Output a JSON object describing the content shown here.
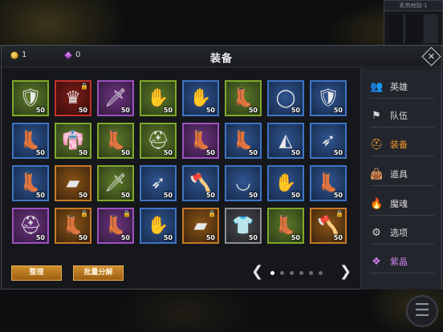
{
  "minimap": {
    "title": "炙热地狱-1"
  },
  "header": {
    "title": "装备",
    "gold": "1",
    "gems": "0",
    "close_icon": "close-x-icon"
  },
  "items": [
    {
      "icon": "chest-armor-icon",
      "glyph": "🛡",
      "rarity": "green",
      "count": "50",
      "locked": false
    },
    {
      "icon": "horned-helmet-icon",
      "glyph": "♛",
      "rarity": "red",
      "count": "50",
      "locked": true
    },
    {
      "icon": "sword-icon",
      "glyph": "🗡",
      "rarity": "purple",
      "count": "50",
      "locked": false
    },
    {
      "icon": "gloves-icon",
      "glyph": "✋",
      "rarity": "green",
      "count": "50",
      "locked": false
    },
    {
      "icon": "gloves-icon",
      "glyph": "✋",
      "rarity": "blue",
      "count": "50",
      "locked": false
    },
    {
      "icon": "boots-icon",
      "glyph": "👢",
      "rarity": "green",
      "count": "50",
      "locked": false
    },
    {
      "icon": "necklace-icon",
      "glyph": "◯",
      "rarity": "blue",
      "count": "50",
      "locked": false
    },
    {
      "icon": "leather-armor-icon",
      "glyph": "🛡",
      "rarity": "blue",
      "count": "50",
      "locked": false
    },
    {
      "icon": "boots-icon",
      "glyph": "👢",
      "rarity": "blue",
      "count": "50",
      "locked": false
    },
    {
      "icon": "robe-icon",
      "glyph": "👘",
      "rarity": "green",
      "count": "50",
      "locked": false
    },
    {
      "icon": "boots-icon",
      "glyph": "👢",
      "rarity": "green",
      "count": "50",
      "locked": false
    },
    {
      "icon": "helmet-icon",
      "glyph": "⛑",
      "rarity": "green",
      "count": "50",
      "locked": false
    },
    {
      "icon": "boots-icon",
      "glyph": "👢",
      "rarity": "purple",
      "count": "50",
      "locked": false
    },
    {
      "icon": "boots-icon",
      "glyph": "👢",
      "rarity": "blue",
      "count": "50",
      "locked": false
    },
    {
      "icon": "hood-icon",
      "glyph": "◭",
      "rarity": "blue",
      "count": "50",
      "locked": false
    },
    {
      "icon": "spear-icon",
      "glyph": "➶",
      "rarity": "blue",
      "count": "50",
      "locked": false
    },
    {
      "icon": "boots-icon",
      "glyph": "👢",
      "rarity": "blue",
      "count": "50",
      "locked": false
    },
    {
      "icon": "shield-icon",
      "glyph": "▰",
      "rarity": "orange",
      "count": "50",
      "locked": false
    },
    {
      "icon": "sword-icon",
      "glyph": "🗡",
      "rarity": "green",
      "count": "50",
      "locked": false
    },
    {
      "icon": "spear-icon",
      "glyph": "➶",
      "rarity": "blue",
      "count": "50",
      "locked": false
    },
    {
      "icon": "axe-icon",
      "glyph": "🪓",
      "rarity": "blue",
      "count": "50",
      "locked": false
    },
    {
      "icon": "scarf-icon",
      "glyph": "◡",
      "rarity": "blue",
      "count": "50",
      "locked": false
    },
    {
      "icon": "gloves-icon",
      "glyph": "✋",
      "rarity": "blue",
      "count": "50",
      "locked": false
    },
    {
      "icon": "boots-icon",
      "glyph": "👢",
      "rarity": "blue",
      "count": "50",
      "locked": false
    },
    {
      "icon": "helmet-icon",
      "glyph": "⛑",
      "rarity": "purple",
      "count": "50",
      "locked": false
    },
    {
      "icon": "boots-icon",
      "glyph": "👢",
      "rarity": "orange",
      "count": "50",
      "locked": true
    },
    {
      "icon": "boots-icon",
      "glyph": "👢",
      "rarity": "purple",
      "count": "50",
      "locked": true
    },
    {
      "icon": "gloves-icon",
      "glyph": "✋",
      "rarity": "blue",
      "count": "50",
      "locked": false
    },
    {
      "icon": "shield-icon",
      "glyph": "▰",
      "rarity": "orange",
      "count": "50",
      "locked": true
    },
    {
      "icon": "shirt-icon",
      "glyph": "👕",
      "rarity": "white",
      "count": "50",
      "locked": false
    },
    {
      "icon": "boots-icon",
      "glyph": "👢",
      "rarity": "green",
      "count": "50",
      "locked": false
    },
    {
      "icon": "axe-icon",
      "glyph": "🪓",
      "rarity": "orange",
      "count": "50",
      "locked": true
    }
  ],
  "buttons": {
    "sort": "整理",
    "batch": "批量分解"
  },
  "pager": {
    "prev": "❮",
    "next": "❯",
    "pages": 6,
    "current": 0
  },
  "nav": [
    {
      "label": "英雄",
      "icon": "hero-icon",
      "glyph": "👥",
      "style": ""
    },
    {
      "label": "队伍",
      "icon": "flag-icon",
      "glyph": "⚑",
      "style": ""
    },
    {
      "label": "装备",
      "icon": "helmet-icon",
      "glyph": "⛑",
      "style": "active"
    },
    {
      "label": "道具",
      "icon": "bag-icon",
      "glyph": "👜",
      "style": ""
    },
    {
      "label": "魔魂",
      "icon": "flame-icon",
      "glyph": "🔥",
      "style": ""
    },
    {
      "label": "选项",
      "icon": "gear-icon",
      "glyph": "⚙",
      "style": ""
    },
    {
      "label": "紫晶",
      "icon": "crystal-icon",
      "glyph": "❖",
      "style": "purple"
    }
  ],
  "corner_icon": {
    "icon": "menu-list-icon",
    "glyph": "☰"
  },
  "colors": {
    "accent": "#f19a2a",
    "crystal": "#c77fe6",
    "rarity_green": "#7fa82c",
    "rarity_blue": "#3f74c4",
    "rarity_purple": "#9c52c0",
    "rarity_orange": "#c77a28",
    "rarity_red": "#c3322b",
    "rarity_white": "#8c8f94"
  }
}
